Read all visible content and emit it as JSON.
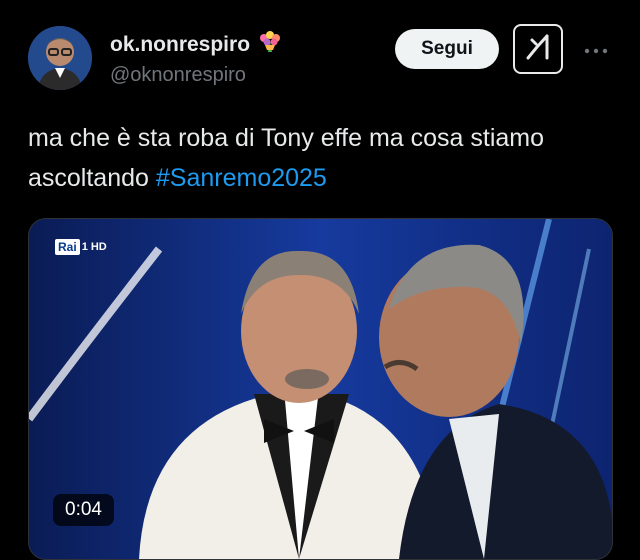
{
  "author": {
    "display_name": "ok.nonrespiro",
    "name_emoji_icon": "bouquet-icon",
    "handle": "@oknonrespiro"
  },
  "actions": {
    "follow_label": "Segui",
    "grok_icon": "grok-icon",
    "more_icon": "more-icon"
  },
  "tweet": {
    "text": "ma che è sta roba di Tony effe ma cosa stiamo ascoltando ",
    "hashtag": "#Sanremo2025"
  },
  "media": {
    "channel_logo": "Rai",
    "channel_number": "1 HD",
    "duration": "0:04"
  },
  "colors": {
    "background": "#000000",
    "text": "#e7e9ea",
    "secondary_text": "#71767b",
    "link": "#1d9bf0",
    "follow_button_bg": "#eff3f4"
  }
}
